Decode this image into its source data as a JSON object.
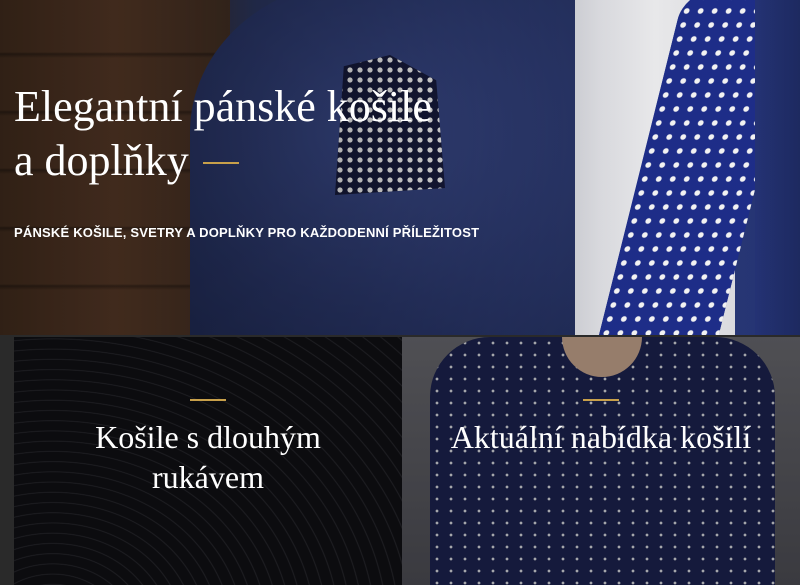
{
  "hero": {
    "title_line1": "Elegantní pánské košile",
    "title_line2": "a doplňky",
    "subtitle": "PÁNSKÉ KOŠILE, SVETRY A DOPLŇKY PRO KAŽDODENNÍ PŘÍLEŽITOST"
  },
  "tiles": [
    {
      "title": "Košile s dlouhým rukávem"
    },
    {
      "title": "Aktuální nabídka košilí"
    }
  ],
  "colors": {
    "accent_gold": "#c8a04a",
    "text": "#ffffff"
  }
}
